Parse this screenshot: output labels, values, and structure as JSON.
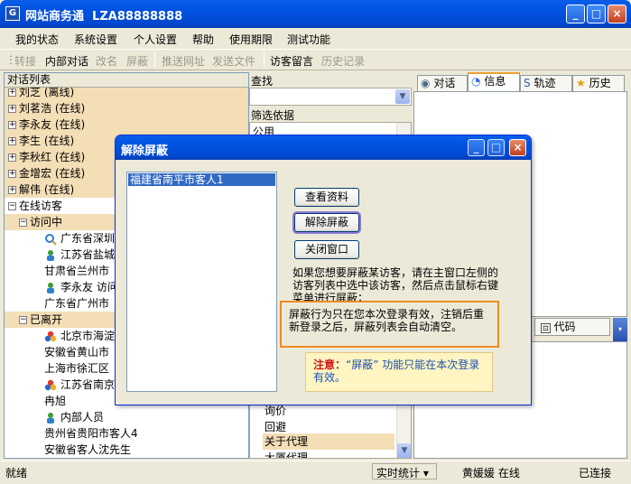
{
  "app": {
    "title": "网站商务通  LZA88888888",
    "icon_glyph": "G"
  },
  "window_buttons": [
    "_",
    "□",
    "×"
  ],
  "menu": [
    "我的状态",
    "系统设置",
    "个人设置",
    "帮助",
    "使用期限",
    "测试功能"
  ],
  "toolbar": [
    "转接",
    "内部对话",
    "改名",
    "屏蔽",
    "推送网址",
    "发送文件",
    "访客留言",
    "历史记录"
  ],
  "left_panel": {
    "header": "对话列表",
    "rows": [
      "刘芝  (离线)",
      "刘茗浩  (在线)",
      "李永友  (在线)",
      "李生  (在线)",
      "李秋红  (在线)",
      "金增宏  (在线)",
      "解伟  (在线)",
      "在线访客",
      "访问中",
      "广东省深圳",
      "江苏省盐城",
      "甘肃省兰州市",
      "李永友 访问",
      "广东省广州市",
      "已离开",
      "北京市海淀",
      "安徽省黄山市",
      "上海市徐汇区",
      "江苏省南京",
      "冉旭",
      "内部人员",
      "贵州省贵阳市客人4",
      "安徽省客人沈先生"
    ]
  },
  "mid_panel": {
    "search_label": "查找",
    "filter_label": "筛选依据",
    "filter_value": "公用",
    "list_items": [
      "询价",
      "回避",
      "关于代理",
      "大厦代理"
    ]
  },
  "right_panel": {
    "tabs": [
      "对话",
      "信息",
      "轨迹",
      "历史"
    ],
    "code_tab": "代码"
  },
  "status": {
    "left": "就绪",
    "stats": "实时统计 ▾",
    "user": "黄媛媛 在线",
    "conn": "已连接"
  },
  "dialog": {
    "title": "解除屏蔽",
    "list_items": [
      "福建省南平市客人1"
    ],
    "btn_view": "查看资料",
    "btn_unblock": "解除屏蔽",
    "btn_close": "关闭窗口",
    "note1": "如果您想要屏蔽某访客，请在主窗口左侧的访客列表中选中该访客，然后点击鼠标右键菜单进行屏蔽；",
    "note2": "屏蔽行为只在您本次登录有效，注销后重新登录之后，屏蔽列表会自动清空。",
    "note3_label": "注意：",
    "note3_text": "“屏蔽” 功能只能在本次登录有效。"
  }
}
